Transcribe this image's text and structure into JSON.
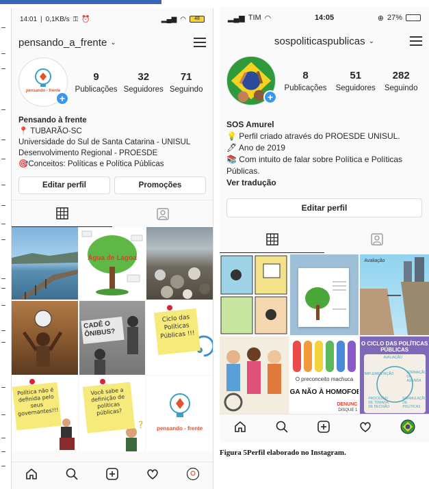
{
  "left_profile": {
    "status": {
      "time": "14:01",
      "speed": "0,1KB/s",
      "battery": "48"
    },
    "username": "pensando_a_frente",
    "avatar_text": "pensando - frente",
    "stats": [
      {
        "num": "9",
        "label": "Publicações"
      },
      {
        "num": "32",
        "label": "Seguidores"
      },
      {
        "num": "71",
        "label": "Seguindo"
      }
    ],
    "bio": {
      "name": "Pensando à frente",
      "lines": [
        "📍 TUBARÃO-SC",
        "Universidade do Sul de Santa Catarina - UNISUL",
        "Desenvolvimento Regional - PROESDE",
        "🎯Conceitos: Políticas e Política Públicas"
      ]
    },
    "buttons": {
      "edit": "Editar perfil",
      "promo": "Promoções"
    },
    "posts": {
      "p2": "Água de Lagoa",
      "p5": "CADÊ O ÔNIBUS?",
      "p6": "Ciclo das Políticas Públicas !!!",
      "p7": "Política não é definida pelo seus governantes!!!",
      "p8": "Você sabe a definição de políticas públicas?",
      "p9": "pensando - frente"
    }
  },
  "right_profile": {
    "status": {
      "carrier": "TIM",
      "time": "14:05",
      "battery": "27%"
    },
    "username": "sospoliticaspublicas",
    "stats": [
      {
        "num": "8",
        "label": "Publicações"
      },
      {
        "num": "51",
        "label": "Seguidores"
      },
      {
        "num": "282",
        "label": "Seguindo"
      }
    ],
    "bio": {
      "name": "SOS Amurel",
      "lines": [
        "💡 Perfil criado através do PROESDE UNISUL.",
        "🖊 Ano de 2019",
        "📚 Com intuito de falar sobre Política e Políticas Públicas."
      ],
      "translate": "Ver tradução"
    },
    "buttons": {
      "edit": "Editar perfil"
    },
    "posts": {
      "p3": "Avaliação",
      "p5a": "O preconceito machuca",
      "p5b": "GA NÃO À HOMOFOBI",
      "p5c": "DENUNC",
      "p5d": "DISQUE 1",
      "p6title": "O CICLO DAS POLÍTICAS PÚBLICAS",
      "p6a": "AVALIAÇÃO",
      "p6b": "IMPLEMENTAÇÃO",
      "p6c": "FORMAÇÃO DA AGENDA",
      "p6d": "PROCESSO DE TOMADA DE DECISÃO",
      "p6e": "FORMULAÇÃO DE POLÍTICAS"
    }
  },
  "caption": "Figura 5Perfil elaborado no Instagram."
}
